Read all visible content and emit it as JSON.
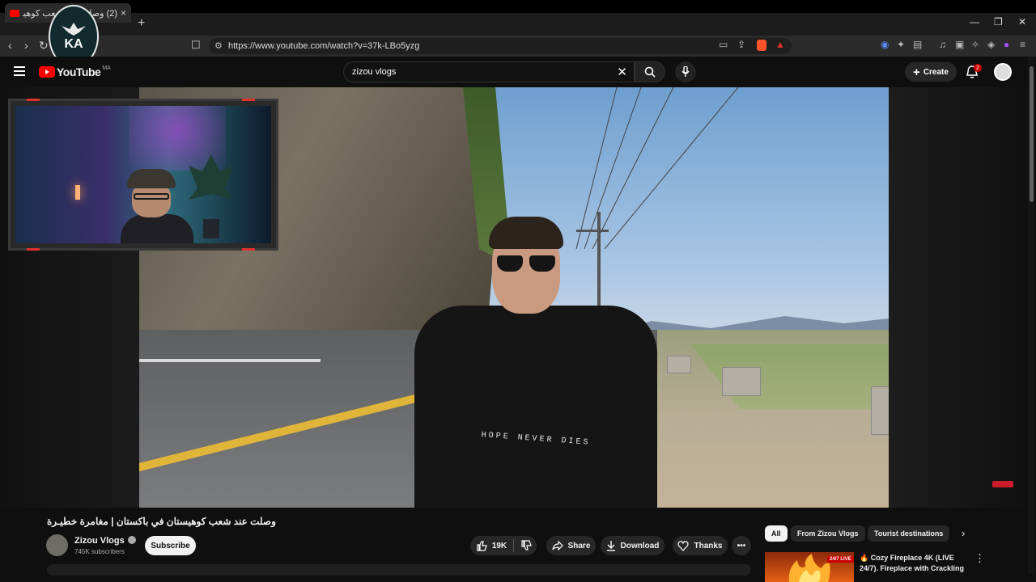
{
  "browser": {
    "tab_title": "(2) وصلت عند شعب كوهيستان",
    "tab_close": "×",
    "new_tab": "+",
    "url": "https://www.youtube.com/watch?v=37k-LBo5yzg",
    "window_controls": [
      "—",
      "❐",
      "✕"
    ]
  },
  "watermark": {
    "text": "KA"
  },
  "header": {
    "logo_text": "YouTube",
    "region": "MA",
    "search_value": "zizou vlogs",
    "create_label": "Create",
    "notification_count": "2"
  },
  "video": {
    "shirt_text": "HOPE NEVER DIES",
    "title": "وصلت عند شعب كوهيستان في باكستان | مغامرة خطيـرة",
    "channel_name": "Zizou Vlogs",
    "subscribers": "745K subscribers",
    "subscribe_label": "Subscribe",
    "likes": "19K",
    "share_label": "Share",
    "download_label": "Download",
    "thanks_label": "Thanks",
    "more_label": "•••"
  },
  "chips": [
    {
      "label": "All",
      "active": true
    },
    {
      "label": "From Zizou Vlogs",
      "active": false
    },
    {
      "label": "Tourist destinations",
      "active": false
    }
  ],
  "recommendation": {
    "live_badge": "LIVE",
    "live_prefix": "24/7",
    "title": "🔥 Cozy Fireplace 4K (LIVE 24/7). Fireplace with Crackling"
  },
  "colors": {
    "accent": "#ff0000",
    "background": "#0f0f0f",
    "chip_active": "#f1f1f1",
    "chip_inactive": "#272727"
  }
}
